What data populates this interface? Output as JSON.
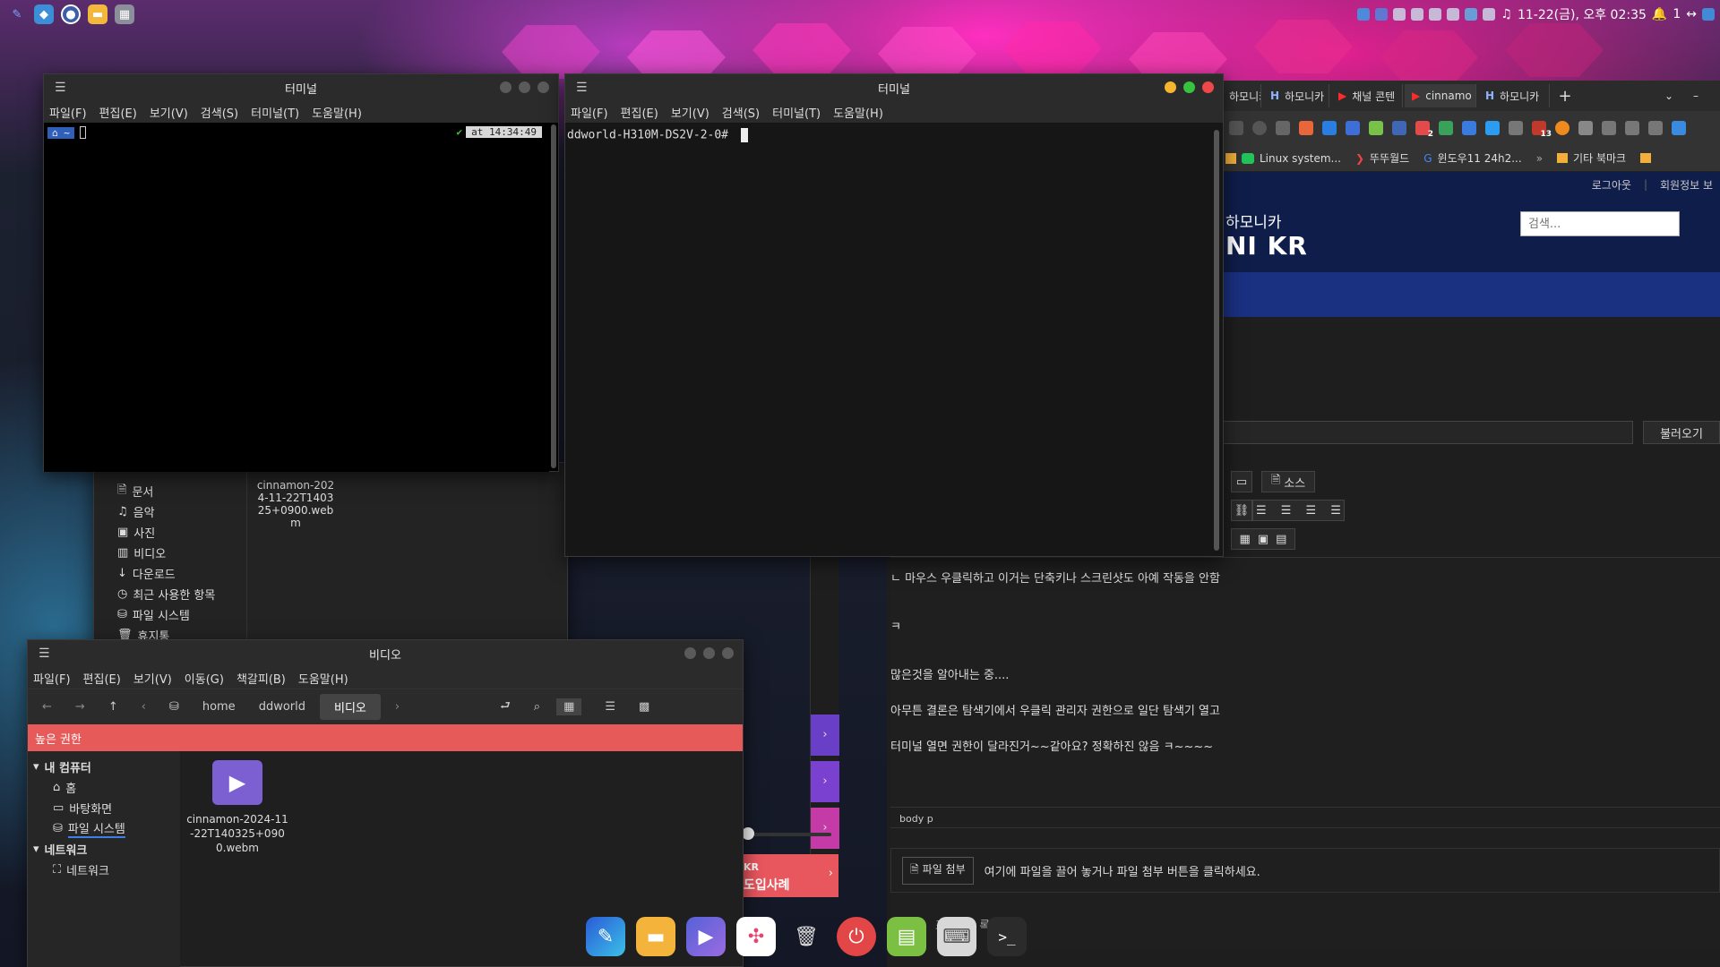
{
  "panel": {
    "clock": "11-22(금), 오후 02:35",
    "notif_count": "1",
    "launchers": [
      "feather-icon",
      "browser-icon",
      "cinnamon-icon",
      "files-icon",
      "apps-icon"
    ]
  },
  "terminal_left": {
    "title": "터미널",
    "menu": [
      "파일(F)",
      "편집(E)",
      "보기(V)",
      "검색(S)",
      "터미널(T)",
      "도움말(H)"
    ],
    "prompt_home": "~",
    "prompt_time": "at 14:34:49",
    "check": "✔"
  },
  "terminal_right": {
    "title": "터미널",
    "menu": [
      "파일(F)",
      "편집(E)",
      "보기(V)",
      "검색(S)",
      "터미널(T)",
      "도움말(H)"
    ],
    "prompt": "ddworld-H310M-DS2V-2-0#"
  },
  "nemo_back": {
    "sidebar": [
      "문서",
      "음악",
      "사진",
      "비디오",
      "다운로드",
      "최근 사용한 항목",
      "파일 시스템",
      "휴지통"
    ],
    "file_label": "cinnamon-2024-11-22T140325+0900.webm"
  },
  "nemo_front": {
    "title": "비디오",
    "menu": [
      "파일(F)",
      "편집(E)",
      "보기(V)",
      "이동(G)",
      "책갈피(B)",
      "도움말(H)"
    ],
    "path": [
      "home",
      "ddworld",
      "비디오"
    ],
    "elevated": "높은 권한",
    "sections": {
      "computer": "내 컴퓨터",
      "items": [
        "홈",
        "바탕화면",
        "파일 시스템"
      ],
      "network": "네트워크",
      "network_items": [
        "네트워크"
      ]
    },
    "file": {
      "name": "cinnamon-2024-11-22T140325+0900.webm"
    }
  },
  "browser": {
    "tabs": [
      "하모니카",
      "하모니카",
      "채널 콘텐",
      "cinnamo",
      "하모니카"
    ],
    "bookmarks": [
      "Linux system...",
      "뚜뚜월드",
      "윈도우11 24h2...",
      "기타 북마크"
    ],
    "badges": {
      "b1": "2",
      "b2": "13"
    },
    "site": {
      "logout": "로그아웃",
      "member": "회원정보 보",
      "brand_ko": "하모니카",
      "brand_en": "NI KR",
      "search_placeholder": "검색...",
      "load_button": "불러오기",
      "source_button": "소스",
      "content": [
        "ㄴ 마우스 우클릭하고 이거는 단축키나 스크린샷도 아예 작동을 안함",
        "ㅋ",
        "많은것을 알아내는 중....",
        "아무튼 결론은 탐색기에서 우클릭 관리자 권한으로 일단 탐색기 열고",
        "터미널 열면 권한이 달라진거~~같아요? 정확하진 않음 ㅋ~~~~"
      ],
      "status_path": "body  p",
      "attach_button": "파일 첨부",
      "attach_hint": "여기에 파일을 끌어 놓거나 파일 첨부 버튼을 클릭하세요.",
      "bottom_text": "표(  하여    록",
      "promo_top": "KR",
      "promo_bottom": "도입사례"
    }
  },
  "dock": [
    "feather-icon",
    "files-icon",
    "video-icon",
    "pinwheel-icon",
    "trash-icon",
    "power-icon",
    "installer-icon",
    "keyboard-icon",
    "terminal-icon"
  ]
}
